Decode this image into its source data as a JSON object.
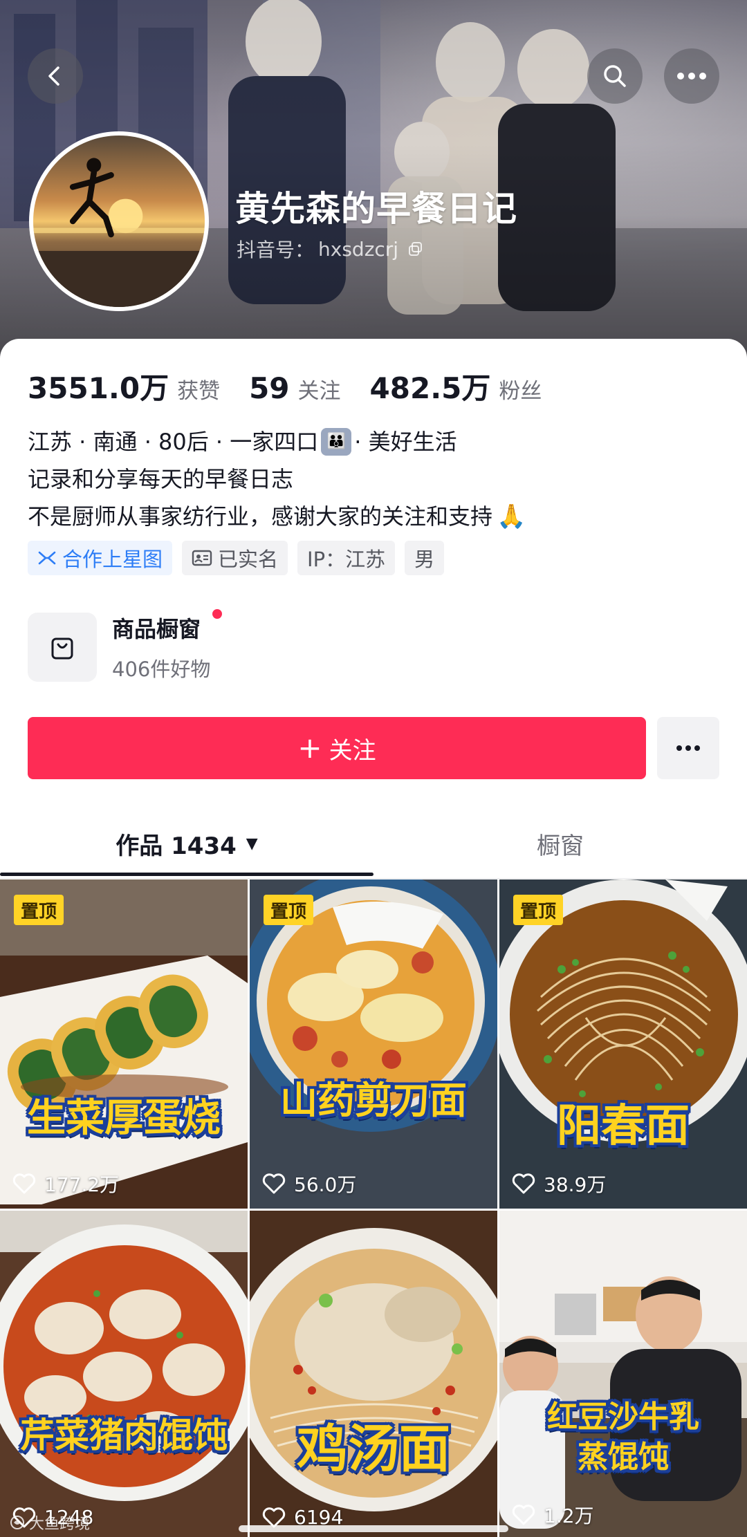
{
  "header": {
    "profile_name": "黄先森的早餐日记",
    "douyin_id_label": "抖音号：",
    "douyin_id": "hxsdzcrj",
    "icons": {
      "back": "back-arrow-icon",
      "search": "search-icon",
      "more": "more-dots-icon",
      "copy": "copy-icon"
    }
  },
  "stats": [
    {
      "value": "3551.0万",
      "label": "获赞"
    },
    {
      "value": "59",
      "label": "关注"
    },
    {
      "value": "482.5万",
      "label": "粉丝"
    }
  ],
  "bio": {
    "line1_a": "江苏 · 南通 · 80后 · 一家四口",
    "line1_emoji": "👪",
    "line1_b": "· 美好生活",
    "line2": "记录和分享每天的早餐日志",
    "line3": "不是厨师从事家纺行业，感谢大家的关注和支持",
    "line3_emoji": "🙏"
  },
  "tags": [
    {
      "label": "合作上星图",
      "icon": "star-map-icon",
      "accent": true
    },
    {
      "label": "已实名",
      "icon": "id-card-icon",
      "accent": false
    },
    {
      "label": "IP：江苏",
      "icon": "",
      "accent": false
    },
    {
      "label": "男",
      "icon": "",
      "accent": false
    }
  ],
  "shop": {
    "title": "商品橱窗",
    "subtitle": "406件好物",
    "icon": "shopping-bag-icon"
  },
  "actions": {
    "follow_label": "关注",
    "follow_color": "#fe2c55"
  },
  "tabs": [
    {
      "label": "作品 1434",
      "active": true
    },
    {
      "label": "橱窗",
      "active": false
    }
  ],
  "videos": [
    {
      "caption": "生菜厚蛋烧",
      "likes": "177.2万",
      "pinned": true,
      "pin_label": "置顶"
    },
    {
      "caption": "山药剪刀面",
      "likes": "56.0万",
      "pinned": true,
      "pin_label": "置顶"
    },
    {
      "caption": "阳春面",
      "likes": "38.9万",
      "pinned": true,
      "pin_label": "置顶"
    },
    {
      "caption": "芹菜猪肉馄饨",
      "likes": "1248",
      "pinned": false,
      "pin_label": ""
    },
    {
      "caption": "鸡汤面",
      "likes": "6194",
      "pinned": false,
      "pin_label": ""
    },
    {
      "caption_line1": "红豆沙牛乳",
      "caption_line2": "蒸馄饨",
      "likes": "1.2万",
      "pinned": false,
      "pin_label": ""
    }
  ],
  "watermark": "大鱼跨境"
}
